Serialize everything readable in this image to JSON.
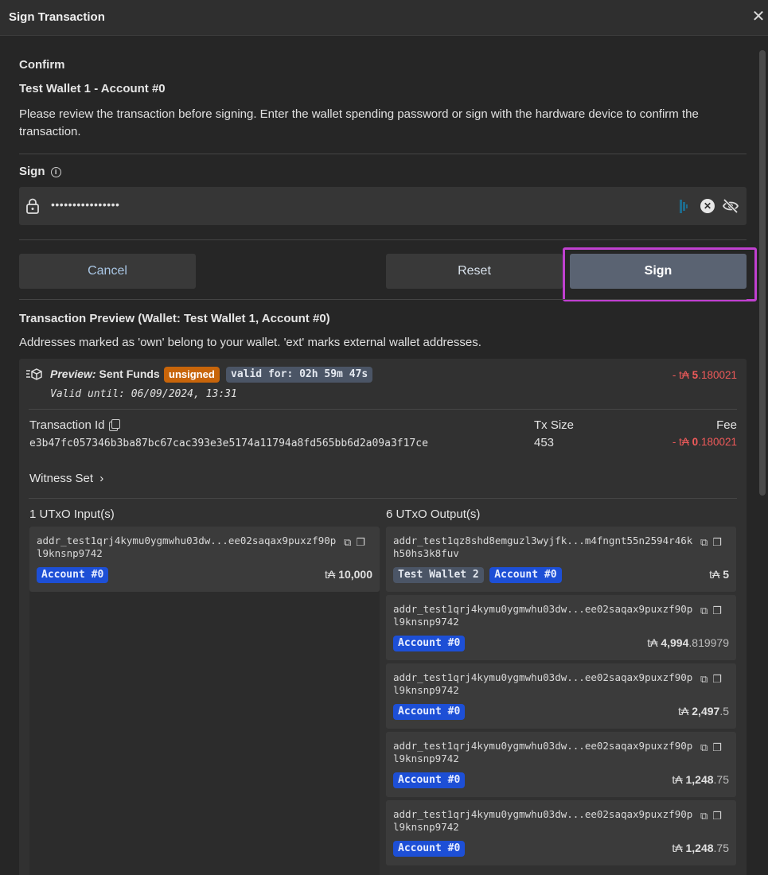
{
  "window": {
    "title": "Sign Transaction"
  },
  "confirm": {
    "heading": "Confirm",
    "wallet": "Test Wallet 1 - Account #0",
    "description": "Please review the transaction before signing. Enter the wallet spending password or sign with the hardware device to confirm the transaction."
  },
  "sign": {
    "label": "Sign",
    "password_value": "••••••••••••••••"
  },
  "buttons": {
    "cancel": "Cancel",
    "reset": "Reset",
    "sign": "Sign"
  },
  "preview": {
    "title": "Transaction Preview (Wallet: Test Wallet 1, Account #0)",
    "note": "Addresses marked as 'own' belong to your wallet. 'ext' marks external wallet addresses.",
    "label_italic": "Preview:",
    "label_text": "Sent Funds",
    "status_badge": "unsigned",
    "valid_for": "valid for: 02h 59m 47s",
    "valid_until": "Valid until: 06/09/2024, 13:31",
    "total": {
      "prefix": "- t₳ ",
      "int": "5",
      "dec": ".180021"
    },
    "tx_id_label": "Transaction Id",
    "tx_id": "e3b47fc057346b3ba87bc67cac393e3e5174a11794a8fd565bb6d2a09a3f17ce",
    "tx_size_label": "Tx Size",
    "tx_size": "453",
    "fee_label": "Fee",
    "fee": {
      "prefix": "- t₳ ",
      "int": "0",
      "dec": ".180021"
    },
    "witness_label": "Witness Set",
    "inputs_label": "1 UTxO Input(s)",
    "outputs_label": "6 UTxO Output(s)"
  },
  "inputs": [
    {
      "addr": "addr_test1qrj4kymu0ygmwhu03dw...ee02saqax9puxzf90pl9knsnp9742",
      "tags": [
        "Account #0"
      ],
      "currency": "t₳",
      "int": "10,000",
      "dec": ""
    }
  ],
  "outputs": [
    {
      "addr": "addr_test1qz8shd8emguzl3wyjfk...m4fngnt55n2594r46kh50hs3k8fuv",
      "tags": [
        "Test Wallet 2",
        "Account #0"
      ],
      "currency": "t₳",
      "int": "5",
      "dec": ""
    },
    {
      "addr": "addr_test1qrj4kymu0ygmwhu03dw...ee02saqax9puxzf90pl9knsnp9742",
      "tags": [
        "Account #0"
      ],
      "currency": "t₳",
      "int": "4,994",
      "dec": ".819979"
    },
    {
      "addr": "addr_test1qrj4kymu0ygmwhu03dw...ee02saqax9puxzf90pl9knsnp9742",
      "tags": [
        "Account #0"
      ],
      "currency": "t₳",
      "int": "2,497",
      "dec": ".5"
    },
    {
      "addr": "addr_test1qrj4kymu0ygmwhu03dw...ee02saqax9puxzf90pl9knsnp9742",
      "tags": [
        "Account #0"
      ],
      "currency": "t₳",
      "int": "1,248",
      "dec": ".75"
    },
    {
      "addr": "addr_test1qrj4kymu0ygmwhu03dw...ee02saqax9puxzf90pl9knsnp9742",
      "tags": [
        "Account #0"
      ],
      "currency": "t₳",
      "int": "1,248",
      "dec": ".75"
    }
  ],
  "colors": {
    "highlight": "#c040d0",
    "negative": "#ef5a5a",
    "unsigned": "#c8650a",
    "tag": "#1d4fd6"
  }
}
